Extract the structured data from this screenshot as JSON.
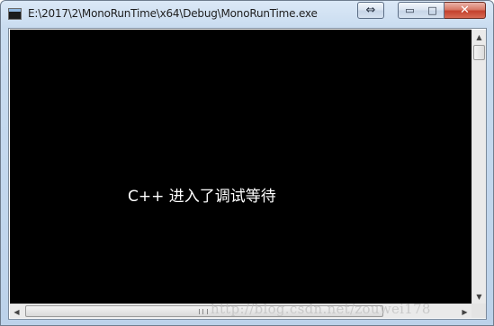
{
  "window": {
    "title": "E:\\2017\\2\\MonoRunTime\\x64\\Debug\\MonoRunTime.exe",
    "icon": "console-app-icon"
  },
  "titlebar_buttons": {
    "switch_label": "⇔",
    "minimize_label": "▭",
    "maximize_label": "□",
    "close_label": "✕"
  },
  "console": {
    "output_text": "C++ 进入了调试等待",
    "background_color": "#000000",
    "text_color": "#ffffff"
  },
  "scrollbars": {
    "up_arrow": "▲",
    "down_arrow": "▼",
    "left_arrow": "◀",
    "right_arrow": "▶"
  },
  "watermark": {
    "text": "http://blog.csdn.net/zouwei178"
  }
}
